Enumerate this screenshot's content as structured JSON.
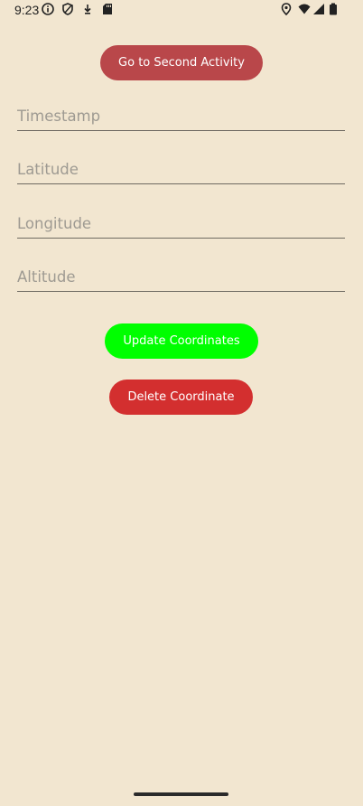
{
  "status_bar": {
    "time": "9:23",
    "left_icons": [
      "info-icon",
      "shield-icon",
      "download-icon",
      "sd-card-icon"
    ],
    "right_icons": [
      "location-icon",
      "wifi-icon",
      "signal-icon",
      "battery-icon"
    ]
  },
  "buttons": {
    "second_activity": "Go to Second Activity",
    "update_coordinates": "Update Coordinates",
    "delete_coordinate": "Delete Coordinate"
  },
  "fields": {
    "timestamp_placeholder": "Timestamp",
    "latitude_placeholder": "Latitude",
    "longitude_placeholder": "Longitude",
    "altitude_placeholder": "Altitude"
  },
  "colors": {
    "background": "#f2e6d0",
    "second_activity_button": "#b9474a",
    "update_button": "#00ff00",
    "delete_button": "#d32f2f"
  }
}
